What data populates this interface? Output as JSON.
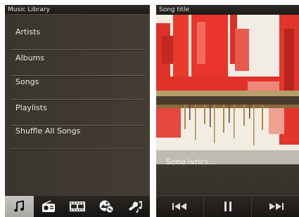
{
  "library": {
    "title": "Music Library",
    "items": [
      {
        "label": "Artists"
      },
      {
        "label": "Albums"
      },
      {
        "label": "Songs"
      },
      {
        "label": "Playlists"
      },
      {
        "label": "Shuffle All Songs"
      }
    ],
    "tabs": [
      {
        "icon": "music-note-icon",
        "active": true
      },
      {
        "icon": "radio-icon",
        "active": false
      },
      {
        "icon": "film-icon",
        "active": false
      },
      {
        "icon": "photos-icon",
        "active": false
      },
      {
        "icon": "karaoke-icon",
        "active": false
      }
    ]
  },
  "player": {
    "title": "Song title",
    "lyrics": "Song lyrics...",
    "controls": [
      "previous-icon",
      "pause-icon",
      "next-icon"
    ]
  },
  "colors": {
    "panel": "#3d382f",
    "text": "#ece8df",
    "accent_red": "#e8322c",
    "active_tab": "#b9b7b3"
  }
}
